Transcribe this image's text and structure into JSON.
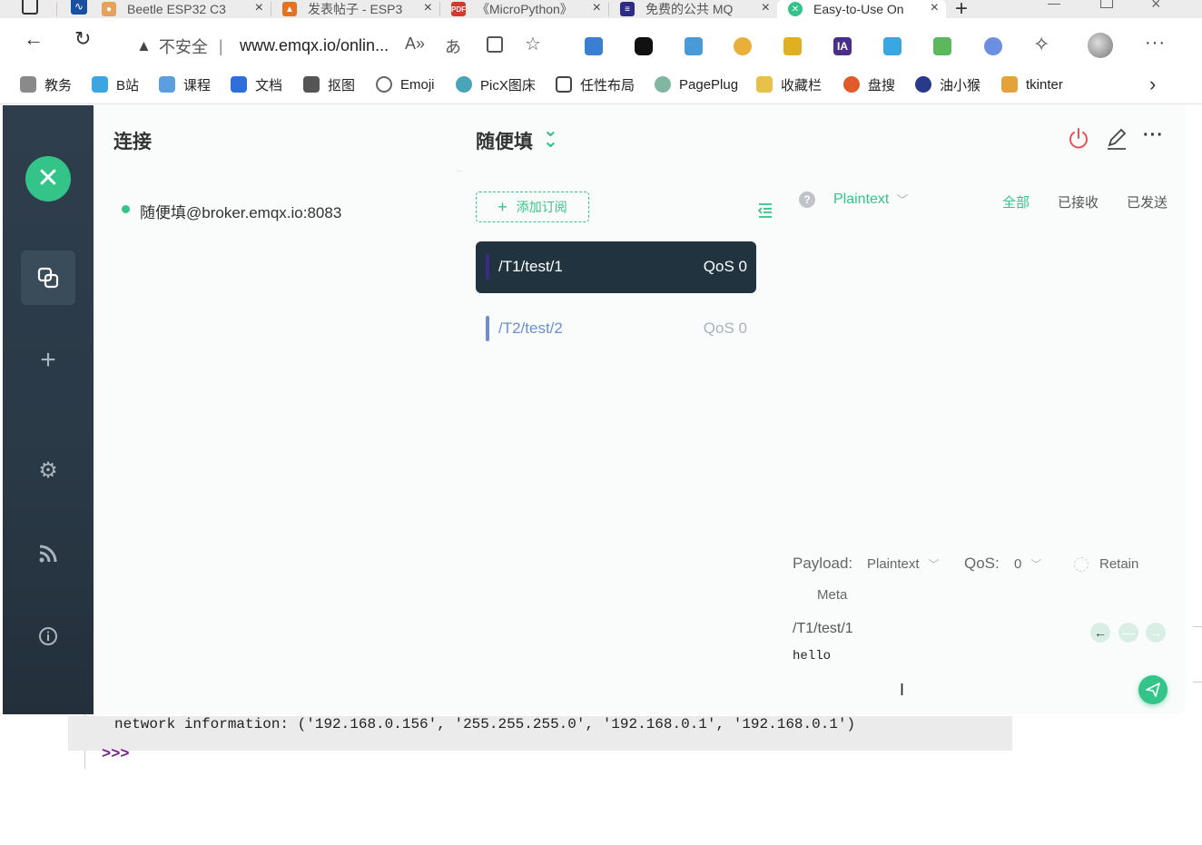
{
  "tabs": [
    {
      "label": "Beetle ESP32 C3",
      "icon": "sloth-icon",
      "color": "#e6a15b"
    },
    {
      "label": "发表帖子 - ESP3",
      "icon": "fox-icon",
      "color": "#e4721f"
    },
    {
      "label": "《MicroPython》",
      "icon": "pdf-icon",
      "color": "#d23a2b"
    },
    {
      "label": "免费的公共 MQ",
      "icon": "document-icon",
      "color": "#2e2a86"
    },
    {
      "label": "Easy-to-Use On",
      "icon": "emqx-icon",
      "color": "#34c388"
    }
  ],
  "address": {
    "security_label": "不安全",
    "url": "www.emqx.io/onlin..."
  },
  "bookmarks": [
    {
      "label": "教务",
      "color": "#8a8a8a"
    },
    {
      "label": "B站",
      "color": "#3aa7e3"
    },
    {
      "label": "课程",
      "color": "#5aa0e0"
    },
    {
      "label": "文档",
      "color": "#2f6fdc"
    },
    {
      "label": "抠图",
      "color": "#555555"
    },
    {
      "label": "Emoji",
      "color": "#888888"
    },
    {
      "label": "PicX图床",
      "color": "#4aa4b8"
    },
    {
      "label": "任性布局",
      "color": "#666666"
    },
    {
      "label": "PagePlug",
      "color": "#7fb7a0"
    },
    {
      "label": "收藏栏",
      "color": "#e8c14a"
    },
    {
      "label": "盘搜",
      "color": "#e25a2a"
    },
    {
      "label": "油小猴",
      "color": "#2a3a8a"
    },
    {
      "label": "tkinter",
      "color": "#e5a23a"
    }
  ],
  "app": {
    "connections_title": "连接",
    "connection_item": "随便填@broker.emqx.io:8083",
    "connection_name": "随便填",
    "add_subscription": "添加订阅",
    "subscriptions": [
      {
        "topic": "/T1/test/1",
        "qos": "QoS 0",
        "bar_color": "#3a2a8a",
        "active": true
      },
      {
        "topic": "/T2/test/2",
        "qos": "QoS 0",
        "bar_color": "#6a8fd0",
        "active": false
      }
    ],
    "filter": {
      "format": "Plaintext",
      "all": "全部",
      "received": "已接收",
      "sent": "已发送"
    },
    "publish": {
      "payload_label": "Payload:",
      "payload_format": "Plaintext",
      "qos_label": "QoS:",
      "qos_value": "0",
      "retain_label": "Retain",
      "meta_label": "Meta",
      "topic": "/T1/test/1",
      "message": "hello"
    },
    "accent_color": "#34c388"
  },
  "console": {
    "output": "network information: ('192.168.0.156', '255.255.255.0', '192.168.0.1', '192.168.0.1')",
    "prompt": ">>>"
  }
}
